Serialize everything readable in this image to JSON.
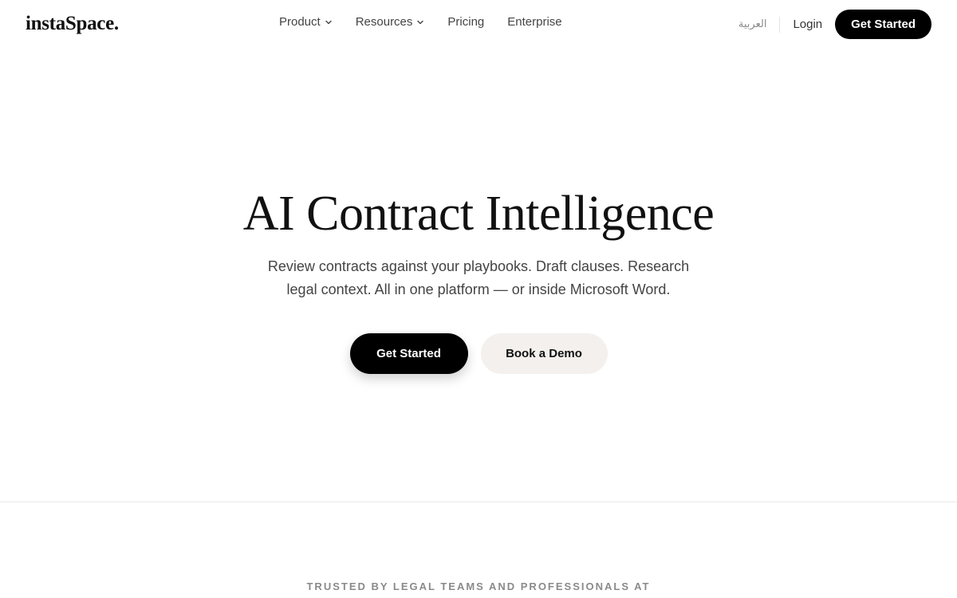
{
  "header": {
    "logo_text": "instaSpace",
    "logo_dot": ".",
    "nav": [
      {
        "label": "Product",
        "has_dropdown": true
      },
      {
        "label": "Resources",
        "has_dropdown": true
      },
      {
        "label": "Pricing",
        "has_dropdown": false
      },
      {
        "label": "Enterprise",
        "has_dropdown": false
      }
    ],
    "language": "العربية",
    "login": "Login",
    "cta": "Get Started"
  },
  "hero": {
    "title": "AI Contract Intelligence",
    "subtitle_line1": "Review contracts against your playbooks. Draft clauses. Research",
    "subtitle_line2": "legal context. All in one platform — or inside Microsoft Word.",
    "primary_cta": "Get Started",
    "secondary_cta": "Book a Demo"
  },
  "trusted": {
    "heading": "TRUSTED BY LEGAL TEAMS AND PROFESSIONALS AT"
  },
  "colors": {
    "primary": "#000000",
    "secondary_bg": "#f3f0ed",
    "text_muted": "#444444"
  }
}
